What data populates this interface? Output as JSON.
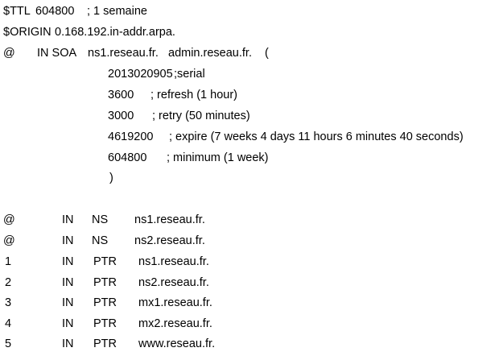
{
  "zone_file": {
    "ttl_directive": {
      "keyword": "$TTL",
      "value": "604800",
      "comment": "; 1 semaine"
    },
    "origin_directive": {
      "keyword": "$ORIGIN",
      "value": "0.168.192.in-addr.arpa."
    },
    "soa": {
      "owner": "@",
      "record": "IN SOA",
      "primary_ns": "ns1.reseau.fr.",
      "admin": "admin.reseau.fr.",
      "open_paren": "(",
      "serial_value": "2013020905",
      "serial_comment": ";serial",
      "refresh_value": "3600",
      "refresh_comment": "; refresh (1 hour)",
      "retry_value": "3000",
      "retry_comment": "; retry (50 minutes)",
      "expire_value": "4619200",
      "expire_comment": "; expire (7 weeks 4 days 11 hours 6 minutes 40 seconds)",
      "minimum_value": "604800",
      "minimum_comment": "; minimum (1 week)",
      "close_paren": ")"
    },
    "records": [
      {
        "owner": "@",
        "class": "IN",
        "type": "NS",
        "target": "ns1.reseau.fr."
      },
      {
        "owner": "@",
        "class": "IN",
        "type": "NS",
        "target": "ns2.reseau.fr."
      },
      {
        "owner": "1",
        "class": "IN",
        "type": "PTR",
        "target": "ns1.reseau.fr."
      },
      {
        "owner": "2",
        "class": "IN",
        "type": "PTR",
        "target": "ns2.reseau.fr."
      },
      {
        "owner": "3",
        "class": "IN",
        "type": "PTR",
        "target": "mx1.reseau.fr."
      },
      {
        "owner": "4",
        "class": "IN",
        "type": "PTR",
        "target": "mx2.reseau.fr."
      },
      {
        "owner": "5",
        "class": "IN",
        "type": "PTR",
        "target": "www.reseau.fr."
      }
    ]
  }
}
